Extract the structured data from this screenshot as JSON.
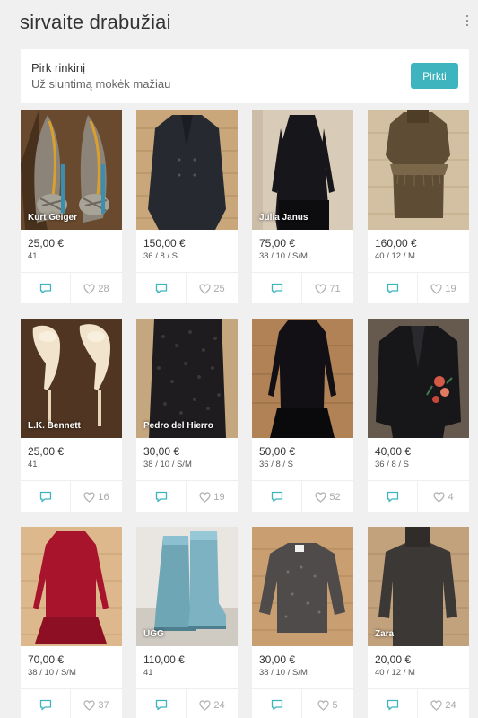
{
  "header": {
    "shop_title": "sirvaite drabužiai",
    "menu_icon": "more-vertical-icon"
  },
  "bundle": {
    "title": "Pirk rinkinį",
    "subtitle": "Už siuntimą mokėk mažiau",
    "button": "Pirkti",
    "accent": "#3db4be"
  },
  "items": [
    {
      "brand": "Kurt Geiger",
      "price": "25,00 €",
      "size": "41",
      "likes": "28",
      "image": "grey-striped-bow-heels"
    },
    {
      "brand": "",
      "price": "150,00 €",
      "size": "36 / 8 / S",
      "likes": "25",
      "image": "dark-double-breasted-coat"
    },
    {
      "brand": "Julia Janus",
      "price": "75,00 €",
      "size": "38 / 10 / S/M",
      "likes": "71",
      "image": "black-long-dress"
    },
    {
      "brand": "",
      "price": "160,00 €",
      "size": "40 / 12 / M",
      "likes": "19",
      "image": "brown-knit-fringe-dress"
    },
    {
      "brand": "L.K. Bennett",
      "price": "25,00 €",
      "size": "41",
      "likes": "16",
      "image": "nude-pumps"
    },
    {
      "brand": "Pedro del Hierro",
      "price": "30,00 €",
      "size": "38 / 10 / S/M",
      "likes": "19",
      "image": "black-lace-skirt"
    },
    {
      "brand": "",
      "price": "50,00 €",
      "size": "36 / 8 / S",
      "likes": "52",
      "image": "black-ruffle-hem-dress"
    },
    {
      "brand": "",
      "price": "40,00 €",
      "size": "36 / 8 / S",
      "likes": "4",
      "image": "black-floral-embroidered-blazer"
    },
    {
      "brand": "",
      "price": "70,00 €",
      "size": "38 / 10 / S/M",
      "likes": "37",
      "image": "red-ruffle-dress"
    },
    {
      "brand": "UGG",
      "price": "110,00 €",
      "size": "41",
      "likes": "24",
      "image": "light-blue-boots"
    },
    {
      "brand": "",
      "price": "30,00 €",
      "size": "38 / 10 / S/M",
      "likes": "5",
      "image": "grey-knit-sweater"
    },
    {
      "brand": "Zara",
      "price": "20,00 €",
      "size": "40 / 12 / M",
      "likes": "24",
      "image": "dark-turtleneck-sweater"
    }
  ],
  "icons": {
    "comment": "comment-icon",
    "like": "heart-icon"
  },
  "colors": {
    "background": "#f0f0f0",
    "card": "#ffffff",
    "comment_icon": "#3db4be",
    "like_icon": "#b0b0b0"
  }
}
